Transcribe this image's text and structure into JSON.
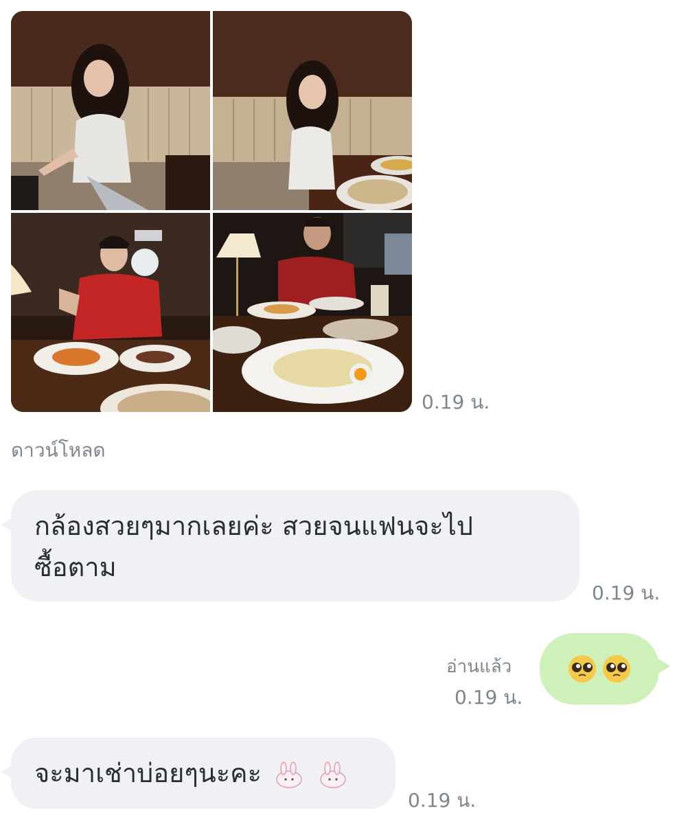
{
  "photos": [
    {
      "name": "photo-woman-booth"
    },
    {
      "name": "photo-woman-table"
    },
    {
      "name": "photo-man-jersey"
    },
    {
      "name": "photo-man-lamp-dinner"
    }
  ],
  "photo_message": {
    "time": "0.19 น."
  },
  "download_label": "ดาวน์โหลด",
  "messages": [
    {
      "side": "received",
      "text_line1": "กล้องสวยๆมากเลยค่ะ สวยจนแฟนจะไป",
      "text_line2": "ซื้อตาม",
      "time": "0.19 น."
    },
    {
      "side": "sent",
      "read_label": "อ่านแล้ว",
      "time": "0.19 น.",
      "emoji": [
        "pleading-face-emoji",
        "pleading-face-emoji"
      ]
    },
    {
      "side": "received",
      "text": "จะมาเช่าบ่อยๆนะคะ",
      "time": "0.19 น.",
      "stickers": [
        "bunny-sticker",
        "bunny-sticker"
      ]
    }
  ]
}
